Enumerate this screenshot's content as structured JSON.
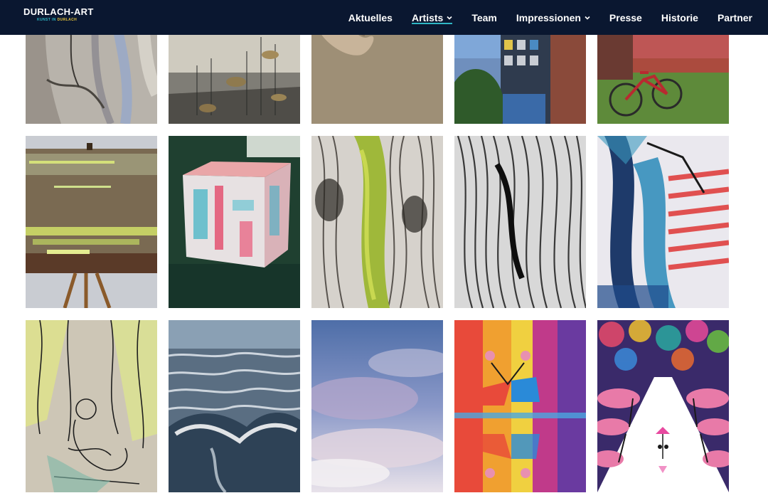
{
  "site": {
    "logo_title": "DURLACH-ART",
    "logo_tag_a": "KUNST IN",
    "logo_tag_b": "DURLACH"
  },
  "nav": {
    "items": [
      {
        "label": "Aktuelles",
        "dropdown": false,
        "active": false
      },
      {
        "label": "Artists",
        "dropdown": true,
        "active": true
      },
      {
        "label": "Team",
        "dropdown": false,
        "active": false
      },
      {
        "label": "Impressionen",
        "dropdown": true,
        "active": false
      },
      {
        "label": "Presse",
        "dropdown": false,
        "active": false
      },
      {
        "label": "Historie",
        "dropdown": false,
        "active": false
      },
      {
        "label": "Partner",
        "dropdown": false,
        "active": false
      }
    ]
  },
  "colors": {
    "navbar_bg": "#0a1730",
    "accent": "#2fb7c5",
    "logo_accent": "#e8c43a"
  },
  "gallery": {
    "tiles": [
      {
        "name": "marble-abstract-painting"
      },
      {
        "name": "fish-painting"
      },
      {
        "name": "carpet-sculpture-photo"
      },
      {
        "name": "painted-tower-building-photo"
      },
      {
        "name": "red-bicycle-photo"
      },
      {
        "name": "easel-abstract-painting"
      },
      {
        "name": "painted-cube-sculpture"
      },
      {
        "name": "green-wood-grain-painting"
      },
      {
        "name": "black-white-wood-drawing"
      },
      {
        "name": "colorful-stripes-painting"
      },
      {
        "name": "tree-ink-sketch"
      },
      {
        "name": "ocean-waves-painting"
      },
      {
        "name": "sky-clouds-painting"
      },
      {
        "name": "dancers-reflection-painting"
      },
      {
        "name": "cherry-blossom-path-painting"
      }
    ]
  }
}
